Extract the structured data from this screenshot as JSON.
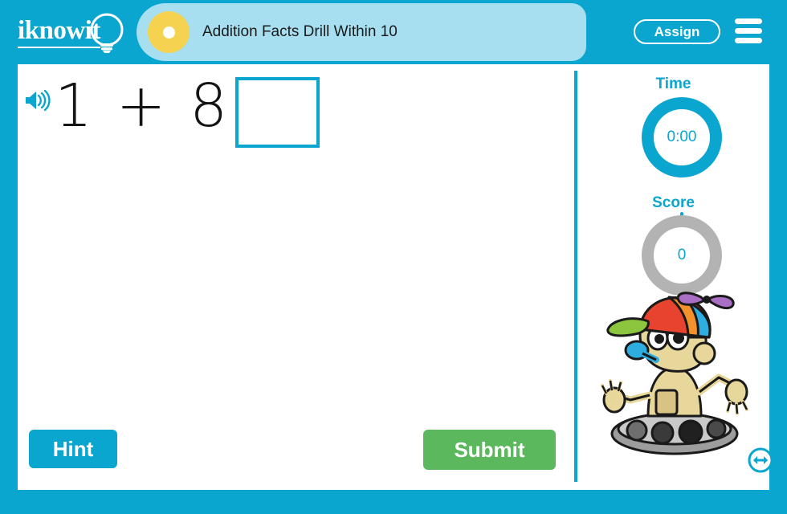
{
  "brand": {
    "logo_text": "iknowit",
    "bulb_icon": "lightbulb-icon"
  },
  "header": {
    "lesson_title": "Addition Facts Drill Within 10",
    "assign_label": "Assign",
    "menu_icon": "hamburger-menu-icon",
    "marker_icon": "lesson-marker-dot",
    "bg_color": "#0aa6d0",
    "tab_color": "#a8dff0",
    "marker_color": "#f5d24f"
  },
  "problem": {
    "speaker_icon": "speaker-audio-icon",
    "equation": "1 + 8 =",
    "operand_left": "1",
    "operator": "+",
    "operand_right": "8",
    "equals": "=",
    "answer_value": "",
    "answer_placeholder": ""
  },
  "actions": {
    "hint_label": "Hint",
    "hint_color": "#0aa6d0",
    "submit_label": "Submit",
    "submit_color": "#5cb85c"
  },
  "panel": {
    "time_label": "Time",
    "time_value": "0:00",
    "time_ring_color": "#0aa6d0",
    "score_label": "Score",
    "score_value": "0",
    "score_ring_color": "#b3b3b3",
    "score_tick_color": "#0aa6d0",
    "mascot_icon": "robot-mascot-propeller-hat",
    "fullscreen_icon": "resize-horizontal-arrows-icon"
  }
}
